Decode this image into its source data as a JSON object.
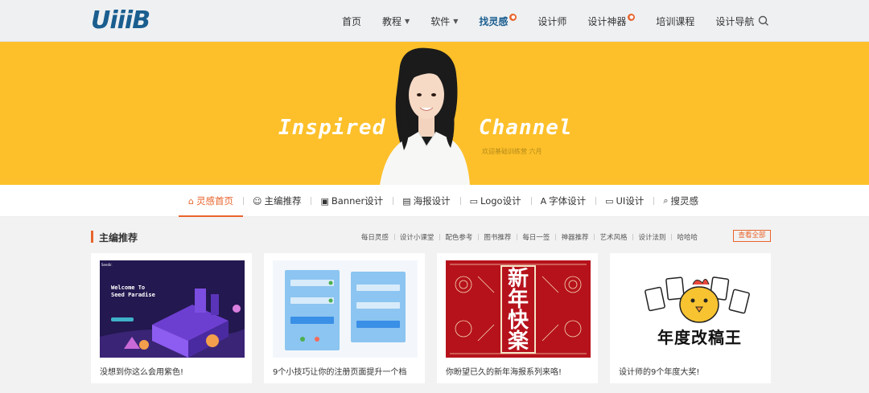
{
  "logo": {
    "text": "UiiiB"
  },
  "nav": {
    "items": [
      {
        "label": "首页"
      },
      {
        "label": "教程",
        "dropdown": true
      },
      {
        "label": "软件",
        "dropdown": true
      },
      {
        "label": "找灵感",
        "badge": "hot",
        "active": true
      },
      {
        "label": "设计师"
      },
      {
        "label": "设计神器",
        "badge": "hot"
      },
      {
        "label": "培训课程"
      },
      {
        "label": "设计导航"
      }
    ],
    "search_icon": "search-icon"
  },
  "banner": {
    "title_left": "Inspired",
    "title_right": "Channel",
    "subtitle": "欢迎基础训练营  六月",
    "background": "#fdc02a"
  },
  "tabs": [
    {
      "label": "灵感首页",
      "icon": "home-icon",
      "glyph": "⌂",
      "active": true
    },
    {
      "label": "主编推荐",
      "icon": "smile-icon",
      "glyph": "☺"
    },
    {
      "label": "Banner设计",
      "icon": "image-icon",
      "glyph": "▣"
    },
    {
      "label": "海报设计",
      "icon": "poster-icon",
      "glyph": "▤"
    },
    {
      "label": "Logo设计",
      "icon": "keyboard-icon",
      "glyph": "▭"
    },
    {
      "label": "字体设计",
      "icon": "font-icon",
      "glyph": "A"
    },
    {
      "label": "UI设计",
      "icon": "monitor-icon",
      "glyph": "▭"
    },
    {
      "label": "搜灵感",
      "icon": "search-icon",
      "glyph": "⌕"
    }
  ],
  "section": {
    "title": "主编推荐",
    "links": [
      "每日灵感",
      "设计小课堂",
      "配色参考",
      "图书推荐",
      "每日一签",
      "神器推荐",
      "艺术风格",
      "设计法则",
      "哈哈哈"
    ],
    "view_all": "查看全部"
  },
  "cards": [
    {
      "caption": "没想到你这么会用紫色!",
      "art": {
        "brand": "Seedir.",
        "headline_1": "Welcome To",
        "headline_2": "Seed Paradise"
      }
    },
    {
      "caption": "9个小技巧让你的注册页面提升一个档"
    },
    {
      "caption": "你盼望已久的新年海报系列来咯!",
      "art": {
        "chars": [
          "新",
          "年",
          "快",
          "楽"
        ]
      }
    },
    {
      "caption": "设计师的9个年度大奖!",
      "art": {
        "award": "年度改稿王"
      }
    }
  ],
  "colors": {
    "accent": "#e8642c",
    "brand_blue": "#1a5e8f",
    "banner_yellow": "#fdc02a"
  }
}
